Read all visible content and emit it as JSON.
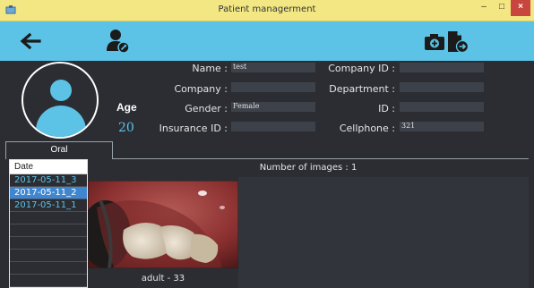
{
  "window": {
    "title": "Patient managerment",
    "minimize_glyph": "–",
    "maximize_glyph": "□",
    "close_glyph": "×"
  },
  "toolbar": {
    "back_icon": "back-arrow-icon",
    "user_icon": "user-edit-icon",
    "capture_icon": "camera-export-icon"
  },
  "patient": {
    "age_label": "Age",
    "age_value": "20",
    "fields": {
      "name": {
        "label": "Name :",
        "value": "test"
      },
      "company": {
        "label": "Company :",
        "value": ""
      },
      "gender": {
        "label": "Gender :",
        "value": "Female"
      },
      "insurance_id": {
        "label": "Insurance ID :",
        "value": ""
      },
      "company_id": {
        "label": "Company ID :",
        "value": ""
      },
      "department": {
        "label": "Department :",
        "value": ""
      },
      "id": {
        "label": "ID :",
        "value": ""
      },
      "cellphone": {
        "label": "Cellphone :",
        "value": "321"
      }
    }
  },
  "tabs": [
    {
      "label": "Oral",
      "active": true
    }
  ],
  "dates": {
    "header": "Date",
    "items": [
      {
        "label": "2017-05-11_3",
        "selected": false
      },
      {
        "label": "2017-05-11_2",
        "selected": true
      },
      {
        "label": "2017-05-11_1",
        "selected": false
      }
    ]
  },
  "images": {
    "count_text": "Number of images : 1",
    "items": [
      {
        "caption": "adult - 33"
      }
    ]
  },
  "colors": {
    "accent": "#5cc3e6",
    "titlebar": "#f2e783",
    "background": "#2b2d33",
    "selection": "#3f86d1",
    "close": "#c8463d"
  }
}
